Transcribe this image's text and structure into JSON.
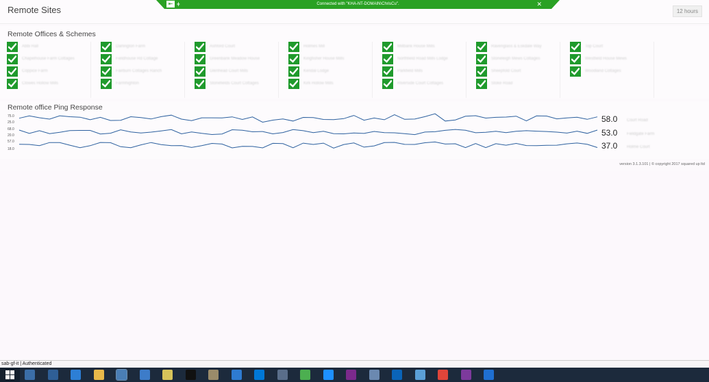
{
  "header": {
    "title": "Remote Sites",
    "range_label": "12 hours"
  },
  "rdp_bar": {
    "text": "Connected with \"KHA-NT-DOMAIN\\ChrisCu\".",
    "close_glyph": "✕"
  },
  "offices": {
    "title": "Remote Offices & Schemes",
    "check_color": "#1f9a2c",
    "columns": [
      [
        "Abbi Hall",
        "Chapelhouse Farm Cottages",
        "Coppice Farm",
        "Clowes Hollow Mills"
      ],
      [
        "Darlington Farm",
        "Fieldhouse Rd Cottage",
        "Fairburn Cottages Ranch",
        "Farmhighton"
      ],
      [
        "Ashford Court",
        "Greenbank Meadow House",
        "Glenhead Court Mills",
        "Stonefields Court Cottages"
      ],
      [
        "Holmes Mill",
        "Kingfisher House Mills",
        "Kendal Lodge",
        "Kirk Hollow Mills"
      ],
      [
        "Millbank House Mills",
        "Northfield Road Mills Lodge",
        "Parkfield Mills",
        "Riverside Court Cottages"
      ],
      [
        "Ravenglass & Eskdale Way",
        "Stoneleigh Mews Cottages",
        "Sheepfold Court",
        "Stoke Road"
      ],
      [
        "Top Court",
        "Westfield House Mews",
        "Woodland Cottages"
      ]
    ]
  },
  "ping": {
    "title": "Remote office Ping Response",
    "line_color": "#2b5f9e",
    "series": [
      {
        "name": "Court Road",
        "current": "58.0",
        "ymax_label": "75.0",
        "ymin_label": "25.0"
      },
      {
        "name": "Fieldgate Farm",
        "current": "53.0",
        "ymax_label": "68.0",
        "ymin_label": "20.0"
      },
      {
        "name": "Holme Court",
        "current": "37.0",
        "ymax_label": "57.0",
        "ymin_label": "18.0"
      }
    ]
  },
  "footer": {
    "version": "version 3.1.3.101  | © copyright 2017 squared up ltd"
  },
  "status_bar": {
    "text": "sab-gf-it | Authenticated"
  },
  "taskbar": {
    "icons": [
      {
        "name": "start-icon"
      },
      {
        "name": "task-view-icon",
        "color": "#3b6ea8"
      },
      {
        "name": "performance-monitor-icon",
        "color": "#2f5f96"
      },
      {
        "name": "onedrive-icon",
        "color": "#2d7fd6"
      },
      {
        "name": "file-explorer-icon",
        "color": "#e8b94a"
      },
      {
        "name": "remote-desktop-icon",
        "color": "#4a7eb5",
        "active": true
      },
      {
        "name": "server-manager-icon",
        "color": "#3d7cc9"
      },
      {
        "name": "notes-icon",
        "color": "#d6c35a"
      },
      {
        "name": "command-prompt-icon",
        "color": "#111111"
      },
      {
        "name": "tools-icon",
        "color": "#9a8b6a"
      },
      {
        "name": "contacts-icon",
        "color": "#2e7bd1"
      },
      {
        "name": "skype-icon",
        "color": "#0078d7"
      },
      {
        "name": "network-icon",
        "color": "#5a6e8a"
      },
      {
        "name": "vsphere-icon",
        "color": "#4caf50"
      },
      {
        "name": "internet-explorer-icon",
        "color": "#1e90ff"
      },
      {
        "name": "onenote-icon",
        "color": "#7b2a8c"
      },
      {
        "name": "remote-tools-icon",
        "color": "#6b89b0"
      },
      {
        "name": "outlook-icon",
        "color": "#0a64b8"
      },
      {
        "name": "notepad-icon",
        "color": "#5b9fd6"
      },
      {
        "name": "chrome-icon",
        "color": "#e0453a"
      },
      {
        "name": "purple-app-icon",
        "color": "#7d3a9c"
      },
      {
        "name": "teamviewer-icon",
        "color": "#1f6fd1"
      }
    ]
  }
}
